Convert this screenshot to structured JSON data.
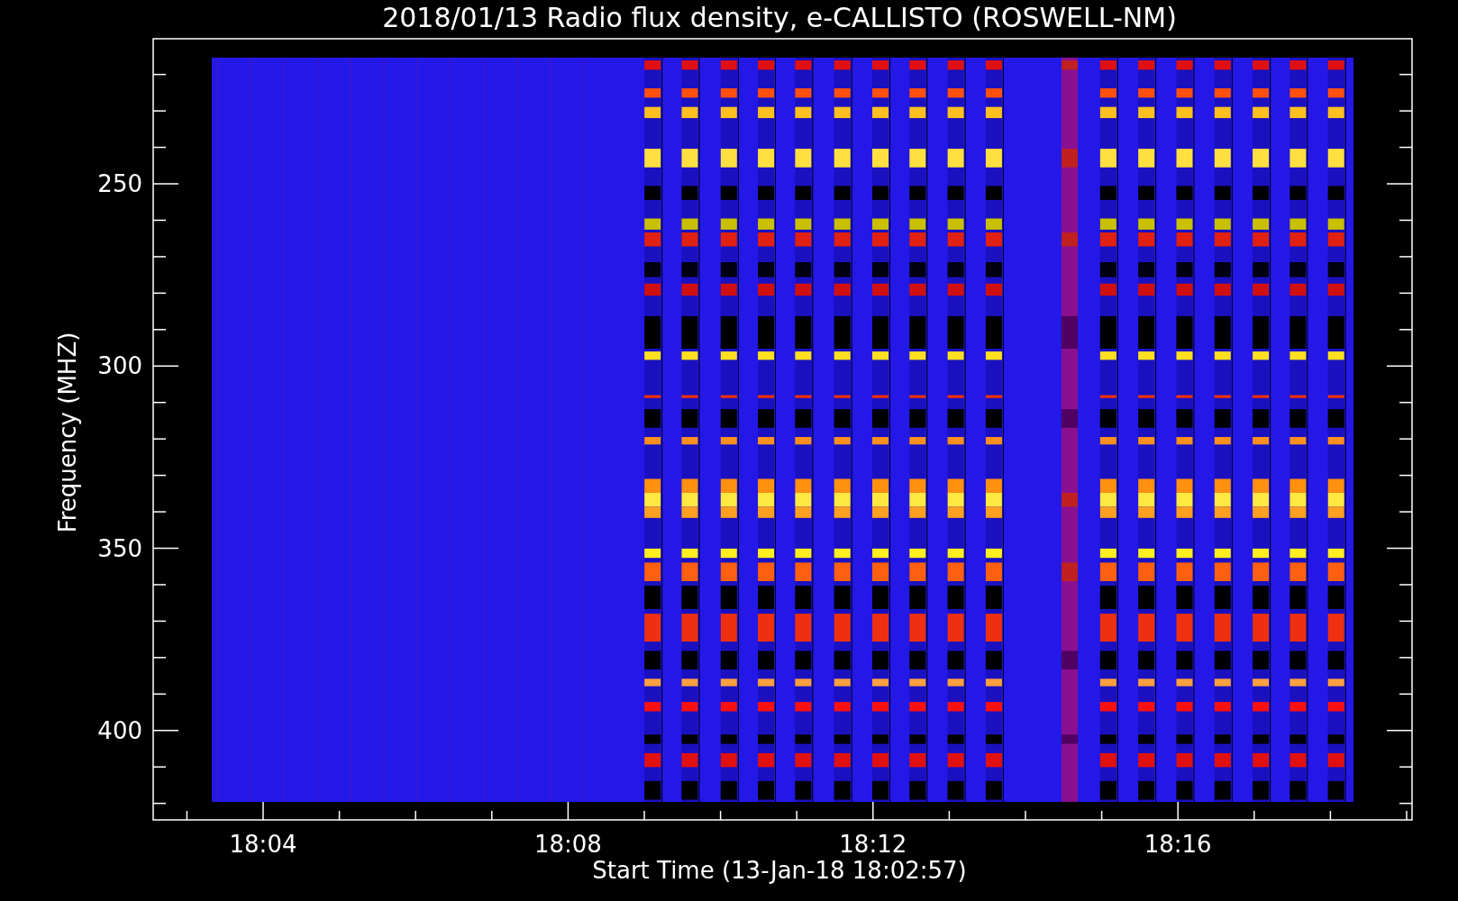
{
  "title": "2018/01/13  Radio flux density, e-CALLISTO (ROSWELL-NM)",
  "y_axis": {
    "label": "Frequency (MHZ)",
    "ticks": [
      "250",
      "300",
      "350",
      "400"
    ]
  },
  "x_axis": {
    "label": "Start Time (13-Jan-18 18:02:57)",
    "ticks": [
      "18:04",
      "18:08",
      "18:12",
      "18:16"
    ]
  }
}
